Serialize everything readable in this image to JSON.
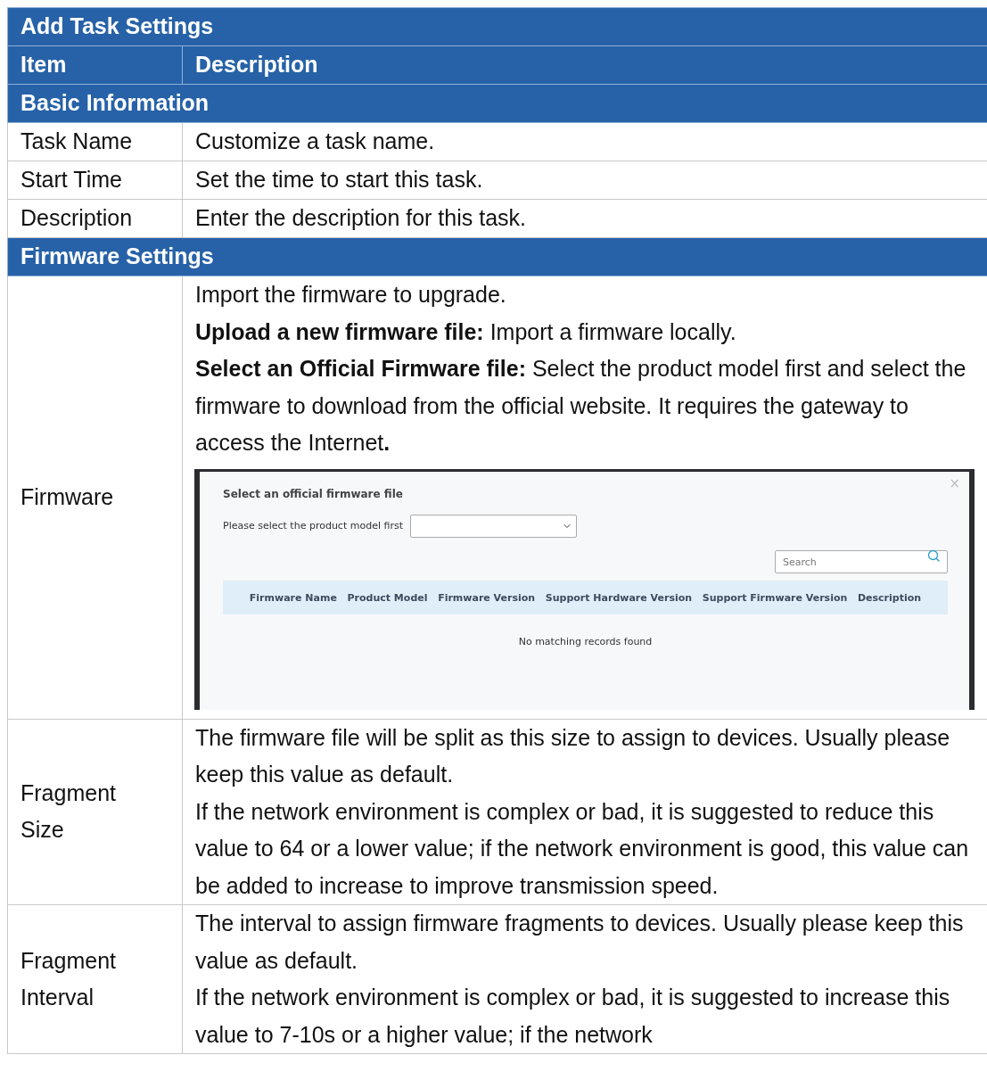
{
  "table": {
    "title": "Add Task Settings",
    "columns": [
      "Item",
      "Description"
    ],
    "sections": [
      {
        "title": "Basic Information",
        "rows": [
          {
            "item": "Task Name",
            "paragraphs": [
              "Customize a task name."
            ]
          },
          {
            "item": "Start Time",
            "paragraphs": [
              "Set the time to start this task."
            ]
          },
          {
            "item": "Description",
            "paragraphs": [
              "Enter the description for this task."
            ]
          }
        ]
      },
      {
        "title": "Firmware Settings",
        "rows": [
          {
            "item": "Firmware",
            "paragraphs": [
              "Import the firmware to upgrade.",
              "**Upload a new firmware file:** Import a firmware locally.",
              "**Select an Official Firmware file:** Select the product model first and select the firmware to download from the official website. It requires the gateway to access the Internet**.**"
            ],
            "screenshot": {
              "title": "Select an official firmware file",
              "close": "×",
              "model_label": "Please select the product model first",
              "search": {
                "placeholder": "Search"
              },
              "columns": [
                "Firmware Name",
                "Product Model",
                "Firmware Version",
                "Support Hardware Version",
                "Support Firmware Version",
                "Description"
              ],
              "empty_message": "No matching records found"
            }
          },
          {
            "item": "Fragment Size",
            "paragraphs": [
              "The firmware file will be split as this size to assign to devices. Usually please keep this value as default.",
              "If the network environment is complex or bad, it is suggested to reduce this value to 64 or a lower value; if the network environment is good, this value can be added to increase to improve transmission speed."
            ]
          },
          {
            "item": "Fragment Interval",
            "paragraphs": [
              "The interval to assign firmware fragments to devices. Usually please keep this value as default.",
              "If the network environment is complex or bad, it is suggested to increase this value to 7-10s or a higher value; if the network"
            ]
          }
        ]
      }
    ]
  }
}
